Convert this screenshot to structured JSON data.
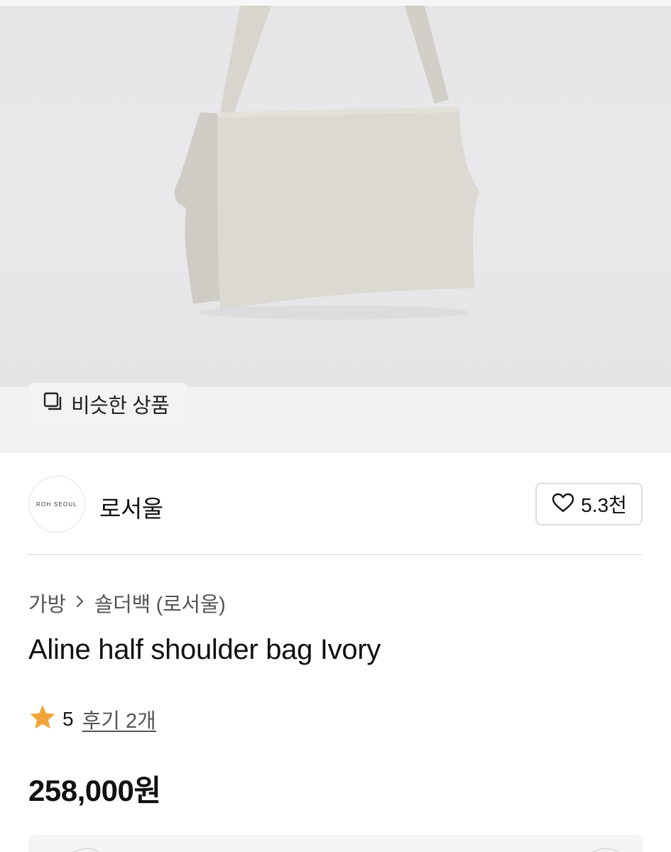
{
  "hero": {
    "similar_button_label": "비슷한 상품",
    "similar_icon": "stacked-squares-icon"
  },
  "seller": {
    "logo_text": "ROH SEOUL",
    "name": "로서울",
    "like_icon": "heart-outline-icon",
    "like_count": "5.3천"
  },
  "breadcrumb": {
    "items": [
      "가방",
      "숄더백 (로서울)"
    ],
    "separator_icon": "chevron-right-icon"
  },
  "product": {
    "title": "Aline half shoulder bag Ivory",
    "rating_icon": "star-icon",
    "rating": "5",
    "review_link": "후기 2개",
    "price": "258,000원"
  },
  "colors": {
    "star": "#F2A33A",
    "bag": "#D9D6CF",
    "hero_background": "#E9E9EB"
  }
}
